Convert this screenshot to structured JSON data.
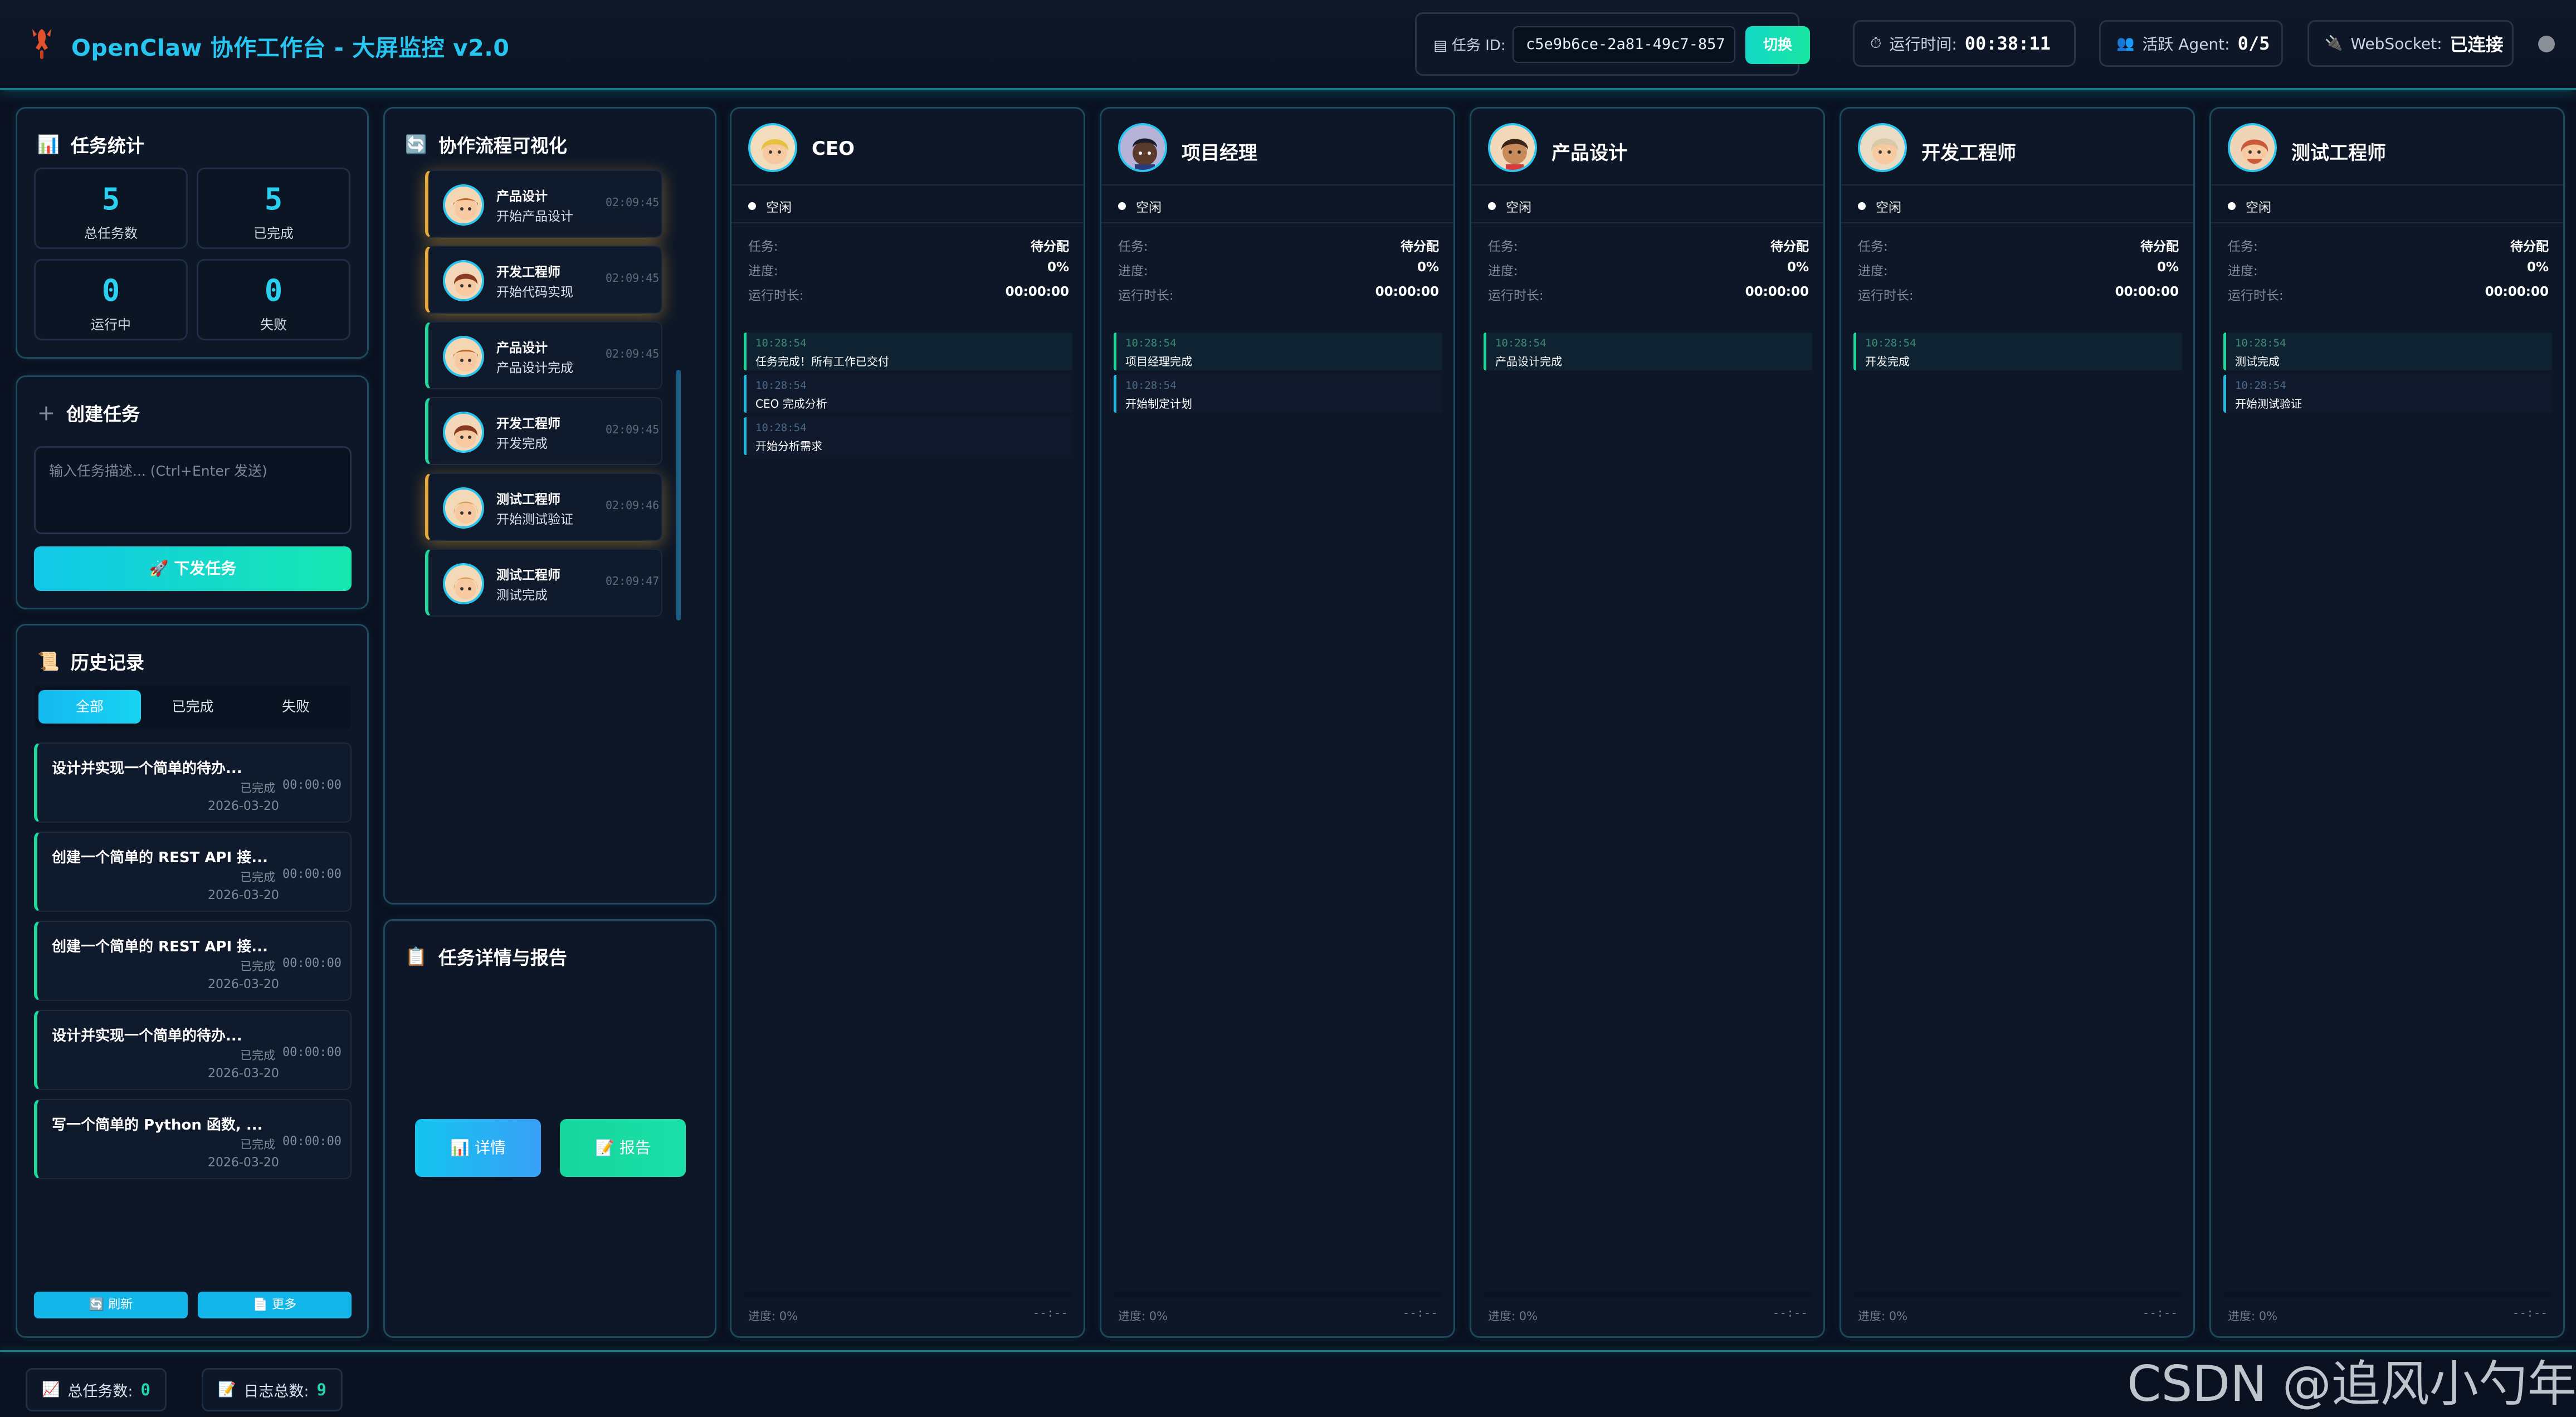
{
  "header": {
    "title": "OpenClaw 协作工作台 - 大屏监控 v2.0",
    "task_id_label": "任务 ID:",
    "task_id_value": "c5e9b6ce-2a81-49c7-857",
    "switch_label": "切换",
    "runtime_label": "运行时间:",
    "runtime_value": "00:38:11",
    "agent_label": "活跃 Agent:",
    "agent_value": "0/5",
    "ws_label": "WebSocket:",
    "ws_value": "已连接",
    "icons": [
      "lobster-icon",
      "clipboard-icon",
      "stopwatch-icon",
      "people-icon",
      "plug-icon"
    ]
  },
  "stats": {
    "title": "任务统计",
    "total": {
      "value": "5",
      "label": "总任务数"
    },
    "done": {
      "value": "5",
      "label": "已完成"
    },
    "running": {
      "value": "0",
      "label": "运行中"
    },
    "failed": {
      "value": "0",
      "label": "失败"
    }
  },
  "create": {
    "title": "创建任务",
    "placeholder": "输入任务描述... (Ctrl+Enter 发送)",
    "button": "🚀 下发任务"
  },
  "history": {
    "title": "历史记录",
    "tabs": [
      "全部",
      "已完成",
      "失败"
    ],
    "items": [
      {
        "title": "设计并实现一个简单的待办...",
        "status": "已完成",
        "time": "00:00:00",
        "date": "2026-03-20"
      },
      {
        "title": "创建一个简单的 REST API 接...",
        "status": "已完成",
        "time": "00:00:00",
        "date": "2026-03-20"
      },
      {
        "title": "创建一个简单的 REST API 接...",
        "status": "已完成",
        "time": "00:00:00",
        "date": "2026-03-20"
      },
      {
        "title": "设计并实现一个简单的待办...",
        "status": "已完成",
        "time": "00:00:00",
        "date": "2026-03-20"
      },
      {
        "title": "写一个简单的 Python 函数, ...",
        "status": "已完成",
        "time": "00:00:00",
        "date": "2026-03-20"
      }
    ],
    "refresh": "🔄 刷新",
    "more": "📄 更多"
  },
  "flow": {
    "title": "协作流程可视化",
    "items": [
      {
        "role": "产品设计",
        "desc": "开始产品设计",
        "time": "02:09:45"
      },
      {
        "role": "开发工程师",
        "desc": "开始代码实现",
        "time": "02:09:45"
      },
      {
        "role": "产品设计",
        "desc": "产品设计完成",
        "time": "02:09:45"
      },
      {
        "role": "开发工程师",
        "desc": "开发完成",
        "time": "02:09:45"
      },
      {
        "role": "测试工程师",
        "desc": "开始测试验证",
        "time": "02:09:46"
      },
      {
        "role": "测试工程师",
        "desc": "测试完成",
        "time": "02:09:47"
      }
    ]
  },
  "detail": {
    "title": "任务详情与报告",
    "detail_button": "📊 详情",
    "report_button": "📝 报告"
  },
  "agent_common": {
    "status": "空闲",
    "task_label": "任务:",
    "task_value": "待分配",
    "progress_label": "进度:",
    "progress_value": "0%",
    "duration_label": "运行时长:",
    "duration_value": "00:00:00",
    "foot_left": "进度: 0%",
    "foot_right": "--:--"
  },
  "agents": [
    {
      "name": "CEO",
      "logs": [
        {
          "time": "10:28:54",
          "text": "任务完成！所有工作已交付"
        },
        {
          "time": "10:28:54",
          "text": "CEO 完成分析"
        },
        {
          "time": "10:28:54",
          "text": "开始分析需求"
        }
      ]
    },
    {
      "name": "项目经理",
      "logs": [
        {
          "time": "10:28:54",
          "text": "项目经理完成"
        },
        {
          "time": "10:28:54",
          "text": "开始制定计划"
        }
      ]
    },
    {
      "name": "产品设计",
      "logs": [
        {
          "time": "10:28:54",
          "text": "产品设计完成"
        }
      ]
    },
    {
      "name": "开发工程师",
      "logs": [
        {
          "time": "10:28:54",
          "text": "开发完成"
        }
      ]
    },
    {
      "name": "测试工程师",
      "logs": [
        {
          "time": "10:28:54",
          "text": "测试完成"
        },
        {
          "time": "10:28:54",
          "text": "开始测试验证"
        }
      ]
    }
  ],
  "footer": {
    "total_tasks_label": "总任务数:",
    "total_tasks_value": "0",
    "logs_label": "日志总数:",
    "logs_value": "9"
  },
  "watermark": "CSDN @追风小勺年",
  "colors": {
    "accent": "#27c6f0",
    "success": "#1fd79a",
    "highlight": "#e8a83a"
  }
}
